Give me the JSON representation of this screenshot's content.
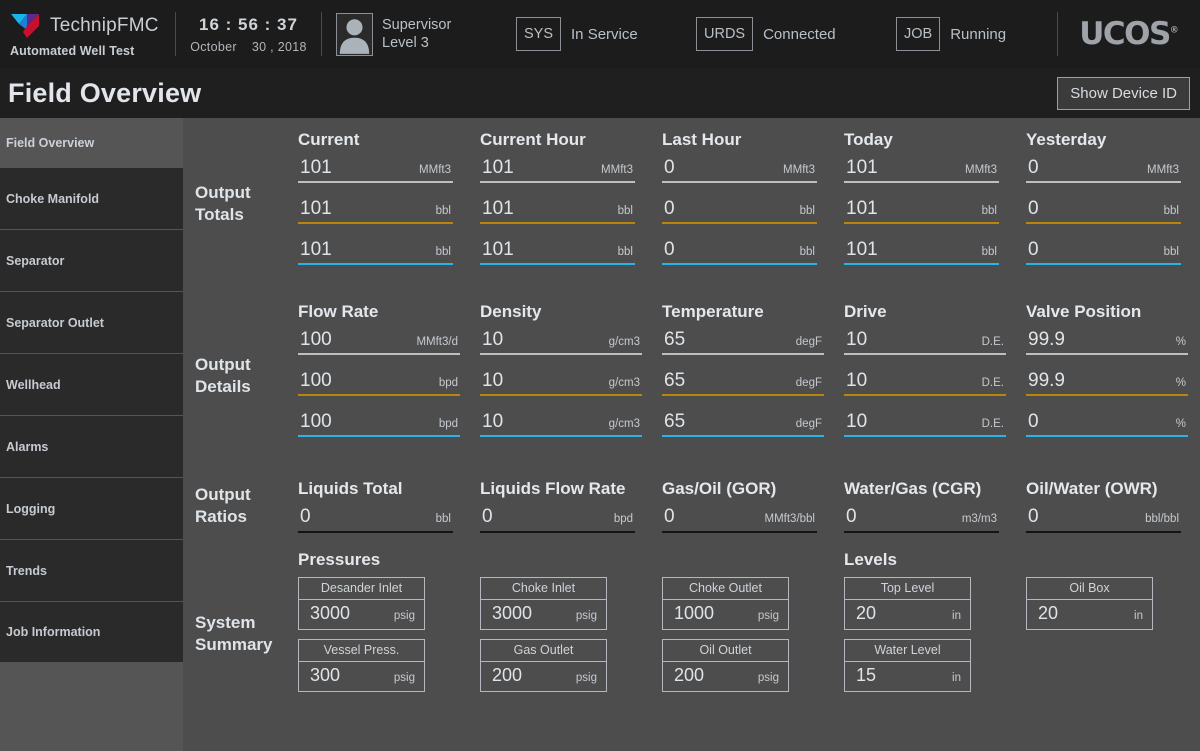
{
  "topbar": {
    "logo_icon": "technipfmc-logo-icon",
    "brand_name": "TechnipFMC",
    "brand_tagline": "Automated Well Test",
    "time": "16 : 56 : 37",
    "date_month": "October",
    "date_day_year": "30 , 2018",
    "avatar_icon": "user-avatar-icon",
    "user_role": "Supervisor",
    "user_level": "Level 3",
    "sys_chip": "SYS",
    "sys_status": "In Service",
    "urds_chip": "URDS",
    "urds_status": "Connected",
    "job_chip": "JOB",
    "job_status": "Running",
    "product_brand": "UCOS",
    "product_brand_mark": "®"
  },
  "titlebar": {
    "title": "Field Overview",
    "show_device_id": "Show Device ID"
  },
  "sidebar": {
    "header": "Field Overview",
    "items": [
      {
        "label": "Choke Manifold"
      },
      {
        "label": "Separator"
      },
      {
        "label": "Separator Outlet"
      },
      {
        "label": "Wellhead"
      },
      {
        "label": "Alarms"
      },
      {
        "label": "Logging"
      },
      {
        "label": "Trends"
      },
      {
        "label": "Job Information"
      }
    ]
  },
  "output_totals": {
    "label": "Output\nTotals",
    "label_line1": "Output",
    "label_line2": "Totals",
    "columns": [
      {
        "title": "Current",
        "rows": [
          {
            "phase": "gas",
            "value": "101",
            "unit": "MMft3"
          },
          {
            "phase": "oil",
            "value": "101",
            "unit": "bbl"
          },
          {
            "phase": "water",
            "value": "101",
            "unit": "bbl"
          }
        ]
      },
      {
        "title": "Current Hour",
        "rows": [
          {
            "phase": "gas",
            "value": "101",
            "unit": "MMft3"
          },
          {
            "phase": "oil",
            "value": "101",
            "unit": "bbl"
          },
          {
            "phase": "water",
            "value": "101",
            "unit": "bbl"
          }
        ]
      },
      {
        "title": "Last Hour",
        "rows": [
          {
            "phase": "gas",
            "value": "0",
            "unit": "MMft3"
          },
          {
            "phase": "oil",
            "value": "0",
            "unit": "bbl"
          },
          {
            "phase": "water",
            "value": "0",
            "unit": "bbl"
          }
        ]
      },
      {
        "title": "Today",
        "rows": [
          {
            "phase": "gas",
            "value": "101",
            "unit": "MMft3"
          },
          {
            "phase": "oil",
            "value": "101",
            "unit": "bbl"
          },
          {
            "phase": "water",
            "value": "101",
            "unit": "bbl"
          }
        ]
      },
      {
        "title": "Yesterday",
        "rows": [
          {
            "phase": "gas",
            "value": "0",
            "unit": "MMft3"
          },
          {
            "phase": "oil",
            "value": "0",
            "unit": "bbl"
          },
          {
            "phase": "water",
            "value": "0",
            "unit": "bbl"
          }
        ]
      }
    ]
  },
  "output_details": {
    "label_line1": "Output",
    "label_line2": "Details",
    "columns": [
      {
        "title": "Flow Rate",
        "rows": [
          {
            "phase": "gas",
            "value": "100",
            "unit": "MMft3/d"
          },
          {
            "phase": "oil",
            "value": "100",
            "unit": "bpd"
          },
          {
            "phase": "water",
            "value": "100",
            "unit": "bpd"
          }
        ]
      },
      {
        "title": "Density",
        "rows": [
          {
            "phase": "gas",
            "value": "10",
            "unit": "g/cm3"
          },
          {
            "phase": "oil",
            "value": "10",
            "unit": "g/cm3"
          },
          {
            "phase": "water",
            "value": "10",
            "unit": "g/cm3"
          }
        ]
      },
      {
        "title": "Temperature",
        "rows": [
          {
            "phase": "gas",
            "value": "65",
            "unit": "degF"
          },
          {
            "phase": "oil",
            "value": "65",
            "unit": "degF"
          },
          {
            "phase": "water",
            "value": "65",
            "unit": "degF"
          }
        ]
      },
      {
        "title": "Drive",
        "rows": [
          {
            "phase": "gas",
            "value": "10",
            "unit": "D.E."
          },
          {
            "phase": "oil",
            "value": "10",
            "unit": "D.E."
          },
          {
            "phase": "water",
            "value": "10",
            "unit": "D.E."
          }
        ]
      },
      {
        "title": "Valve Position",
        "rows": [
          {
            "phase": "gas",
            "value": "99.9",
            "unit": "%"
          },
          {
            "phase": "oil",
            "value": "99.9",
            "unit": "%"
          },
          {
            "phase": "water",
            "value": "0",
            "unit": "%"
          }
        ]
      }
    ]
  },
  "output_ratios": {
    "label_line1": "Output",
    "label_line2": "Ratios",
    "columns": [
      {
        "title": "Liquids Total",
        "value": "0",
        "unit": "bbl"
      },
      {
        "title": "Liquids Flow Rate",
        "value": "0",
        "unit": "bpd"
      },
      {
        "title": "Gas/Oil (GOR)",
        "value": "0",
        "unit": "MMft3/bbl"
      },
      {
        "title": "Water/Gas (CGR)",
        "value": "0",
        "unit": "m3/m3"
      },
      {
        "title": "Oil/Water (OWR)",
        "value": "0",
        "unit": "bbl/bbl"
      }
    ]
  },
  "system_summary": {
    "label_line1": "System",
    "label_line2": "Summary",
    "pressures": {
      "title": "Pressures",
      "columns": [
        [
          {
            "label": "Desander Inlet",
            "value": "3000",
            "unit": "psig"
          },
          {
            "label": "Vessel Press.",
            "value": "300",
            "unit": "psig"
          }
        ],
        [
          {
            "label": "Choke Inlet",
            "value": "3000",
            "unit": "psig"
          },
          {
            "label": "Gas Outlet",
            "value": "200",
            "unit": "psig"
          }
        ],
        [
          {
            "label": "Choke Outlet",
            "value": "1000",
            "unit": "psig"
          },
          {
            "label": "Oil Outlet",
            "value": "200",
            "unit": "psig"
          }
        ]
      ]
    },
    "levels": {
      "title": "Levels",
      "columns": [
        [
          {
            "label": "Top Level",
            "value": "20",
            "unit": "in"
          },
          {
            "label": "Water Level",
            "value": "15",
            "unit": "in"
          }
        ],
        [
          {
            "label": "Oil Box",
            "value": "20",
            "unit": "in"
          }
        ]
      ]
    }
  },
  "colors": {
    "gas": "#bfbfbf",
    "oil": "#b8860b",
    "water": "#2bb3e8",
    "plain": "#141414",
    "background": "#4d4d4d",
    "topbar": "#1c1c1c",
    "titlebar": "#1f1f1f",
    "sidebar_item": "#2a2a2a"
  }
}
